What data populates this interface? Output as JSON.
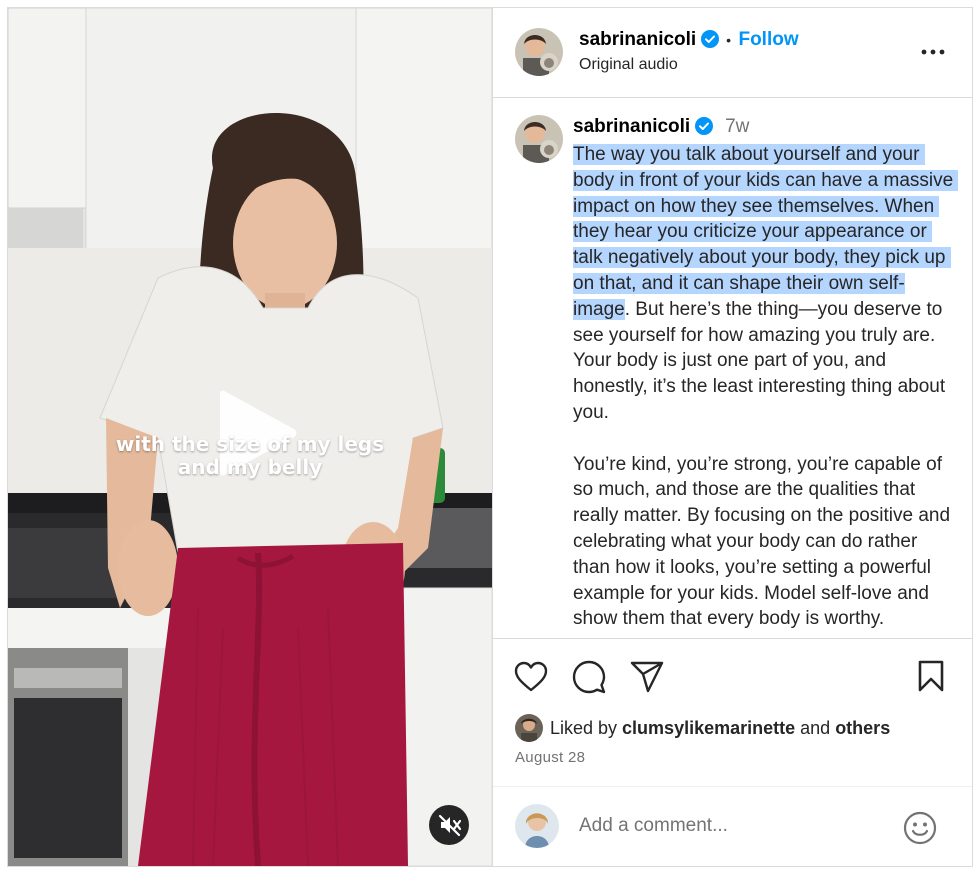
{
  "video": {
    "overlay_line1": "with the size of my legs",
    "overlay_line2": "and my belly",
    "play_icon": "play-icon",
    "mute_icon": "speaker-muted-icon"
  },
  "header": {
    "username": "sabrinanicoli",
    "separator": "•",
    "follow_label": "Follow",
    "audio": "Original audio",
    "more_icon": "more-horizontal-icon"
  },
  "caption": {
    "username": "sabrinanicoli",
    "time": "7w",
    "text_highlighted": "The way you talk about yourself and your body in front of your kids can have a massive impact on how they see themselves. When they hear you criticize your appearance or talk negatively about your body, they pick up on that, and it can shape their own self-image",
    "text_rest": ". But here’s the thing—you deserve to see yourself for how amazing you truly are. Your body is just one part of you, and honestly, it’s the least interesting thing about you.\n\nYou’re kind, you’re strong, you’re capable of so much, and those are the qualities that really matter. By focusing on the positive and celebrating what your body can do rather than how it looks, you’re setting a powerful example for your kids. Model self-love and show them that every body is worthy."
  },
  "actions": {
    "like_icon": "heart-icon",
    "comment_icon": "comment-icon",
    "share_icon": "share-icon",
    "save_icon": "bookmark-icon"
  },
  "likes": {
    "prefix": "Liked by ",
    "user": "clumsylikemarinette",
    "middle": " and ",
    "others": "others"
  },
  "date": "August 28",
  "comment_box": {
    "placeholder": "Add a comment...",
    "emoji_icon": "emoji-icon"
  },
  "colors": {
    "accent": "#0095f6",
    "highlight": "#b4d5fe",
    "border": "#dbdbdb",
    "muted_text": "#737373"
  }
}
